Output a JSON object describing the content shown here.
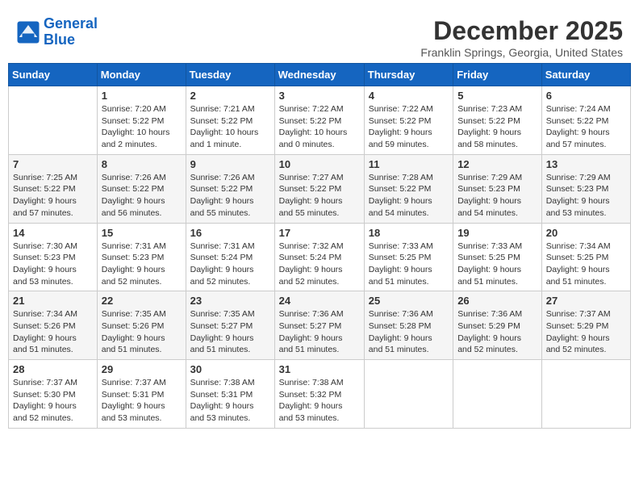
{
  "logo": {
    "line1": "General",
    "line2": "Blue"
  },
  "title": "December 2025",
  "location": "Franklin Springs, Georgia, United States",
  "days_header": [
    "Sunday",
    "Monday",
    "Tuesday",
    "Wednesday",
    "Thursday",
    "Friday",
    "Saturday"
  ],
  "weeks": [
    [
      {
        "day": "",
        "info": ""
      },
      {
        "day": "1",
        "info": "Sunrise: 7:20 AM\nSunset: 5:22 PM\nDaylight: 10 hours\nand 2 minutes."
      },
      {
        "day": "2",
        "info": "Sunrise: 7:21 AM\nSunset: 5:22 PM\nDaylight: 10 hours\nand 1 minute."
      },
      {
        "day": "3",
        "info": "Sunrise: 7:22 AM\nSunset: 5:22 PM\nDaylight: 10 hours\nand 0 minutes."
      },
      {
        "day": "4",
        "info": "Sunrise: 7:22 AM\nSunset: 5:22 PM\nDaylight: 9 hours\nand 59 minutes."
      },
      {
        "day": "5",
        "info": "Sunrise: 7:23 AM\nSunset: 5:22 PM\nDaylight: 9 hours\nand 58 minutes."
      },
      {
        "day": "6",
        "info": "Sunrise: 7:24 AM\nSunset: 5:22 PM\nDaylight: 9 hours\nand 57 minutes."
      }
    ],
    [
      {
        "day": "7",
        "info": "Sunrise: 7:25 AM\nSunset: 5:22 PM\nDaylight: 9 hours\nand 57 minutes."
      },
      {
        "day": "8",
        "info": "Sunrise: 7:26 AM\nSunset: 5:22 PM\nDaylight: 9 hours\nand 56 minutes."
      },
      {
        "day": "9",
        "info": "Sunrise: 7:26 AM\nSunset: 5:22 PM\nDaylight: 9 hours\nand 55 minutes."
      },
      {
        "day": "10",
        "info": "Sunrise: 7:27 AM\nSunset: 5:22 PM\nDaylight: 9 hours\nand 55 minutes."
      },
      {
        "day": "11",
        "info": "Sunrise: 7:28 AM\nSunset: 5:22 PM\nDaylight: 9 hours\nand 54 minutes."
      },
      {
        "day": "12",
        "info": "Sunrise: 7:29 AM\nSunset: 5:23 PM\nDaylight: 9 hours\nand 54 minutes."
      },
      {
        "day": "13",
        "info": "Sunrise: 7:29 AM\nSunset: 5:23 PM\nDaylight: 9 hours\nand 53 minutes."
      }
    ],
    [
      {
        "day": "14",
        "info": "Sunrise: 7:30 AM\nSunset: 5:23 PM\nDaylight: 9 hours\nand 53 minutes."
      },
      {
        "day": "15",
        "info": "Sunrise: 7:31 AM\nSunset: 5:23 PM\nDaylight: 9 hours\nand 52 minutes."
      },
      {
        "day": "16",
        "info": "Sunrise: 7:31 AM\nSunset: 5:24 PM\nDaylight: 9 hours\nand 52 minutes."
      },
      {
        "day": "17",
        "info": "Sunrise: 7:32 AM\nSunset: 5:24 PM\nDaylight: 9 hours\nand 52 minutes."
      },
      {
        "day": "18",
        "info": "Sunrise: 7:33 AM\nSunset: 5:25 PM\nDaylight: 9 hours\nand 51 minutes."
      },
      {
        "day": "19",
        "info": "Sunrise: 7:33 AM\nSunset: 5:25 PM\nDaylight: 9 hours\nand 51 minutes."
      },
      {
        "day": "20",
        "info": "Sunrise: 7:34 AM\nSunset: 5:25 PM\nDaylight: 9 hours\nand 51 minutes."
      }
    ],
    [
      {
        "day": "21",
        "info": "Sunrise: 7:34 AM\nSunset: 5:26 PM\nDaylight: 9 hours\nand 51 minutes."
      },
      {
        "day": "22",
        "info": "Sunrise: 7:35 AM\nSunset: 5:26 PM\nDaylight: 9 hours\nand 51 minutes."
      },
      {
        "day": "23",
        "info": "Sunrise: 7:35 AM\nSunset: 5:27 PM\nDaylight: 9 hours\nand 51 minutes."
      },
      {
        "day": "24",
        "info": "Sunrise: 7:36 AM\nSunset: 5:27 PM\nDaylight: 9 hours\nand 51 minutes."
      },
      {
        "day": "25",
        "info": "Sunrise: 7:36 AM\nSunset: 5:28 PM\nDaylight: 9 hours\nand 51 minutes."
      },
      {
        "day": "26",
        "info": "Sunrise: 7:36 AM\nSunset: 5:29 PM\nDaylight: 9 hours\nand 52 minutes."
      },
      {
        "day": "27",
        "info": "Sunrise: 7:37 AM\nSunset: 5:29 PM\nDaylight: 9 hours\nand 52 minutes."
      }
    ],
    [
      {
        "day": "28",
        "info": "Sunrise: 7:37 AM\nSunset: 5:30 PM\nDaylight: 9 hours\nand 52 minutes."
      },
      {
        "day": "29",
        "info": "Sunrise: 7:37 AM\nSunset: 5:31 PM\nDaylight: 9 hours\nand 53 minutes."
      },
      {
        "day": "30",
        "info": "Sunrise: 7:38 AM\nSunset: 5:31 PM\nDaylight: 9 hours\nand 53 minutes."
      },
      {
        "day": "31",
        "info": "Sunrise: 7:38 AM\nSunset: 5:32 PM\nDaylight: 9 hours\nand 53 minutes."
      },
      {
        "day": "",
        "info": ""
      },
      {
        "day": "",
        "info": ""
      },
      {
        "day": "",
        "info": ""
      }
    ]
  ]
}
